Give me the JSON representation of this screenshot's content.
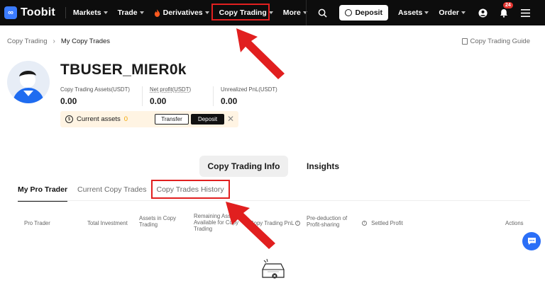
{
  "brand": {
    "name": "Toobit",
    "accent": "#3b7cff"
  },
  "nav": {
    "items": [
      {
        "label": "Markets"
      },
      {
        "label": "Trade"
      },
      {
        "label": "Derivatives"
      },
      {
        "label": "Copy Trading"
      },
      {
        "label": "More"
      }
    ],
    "deposit_label": "Deposit",
    "assets_label": "Assets",
    "order_label": "Order",
    "notification_count": "24"
  },
  "breadcrumb": {
    "root": "Copy Trading",
    "current": "My Copy Trades"
  },
  "guide_label": "Copy Trading Guide",
  "profile": {
    "username": "TBUSER_MIER0k",
    "stats": [
      {
        "label": "Copy Trading Assets(USDT)",
        "value": "0.00"
      },
      {
        "label": "Net profit(USDT)",
        "value": "0.00"
      },
      {
        "label": "Unrealized PnL(USDT)",
        "value": "0.00"
      }
    ],
    "current_assets_label": "Current assets",
    "current_assets_value": "0",
    "transfer_label": "Transfer",
    "deposit_label": "Deposit"
  },
  "main_tabs": [
    {
      "label": "Copy Trading Info"
    },
    {
      "label": "Insights"
    }
  ],
  "sub_tabs": [
    {
      "label": "My Pro Trader"
    },
    {
      "label": "Current Copy Trades"
    },
    {
      "label": "Copy Trades History"
    }
  ],
  "table": {
    "columns": [
      {
        "label": "Pro Trader"
      },
      {
        "label": "Total Investment"
      },
      {
        "label": "Assets in Copy Trading"
      },
      {
        "label": "Remaining Assets Available for Copy Trading"
      },
      {
        "label": "Copy Trading PnL"
      },
      {
        "label": "Pre-deduction of Profit-sharing"
      },
      {
        "label": "Settled Profit"
      },
      {
        "label": "Actions"
      }
    ]
  },
  "highlight_color": "#e11f1f"
}
